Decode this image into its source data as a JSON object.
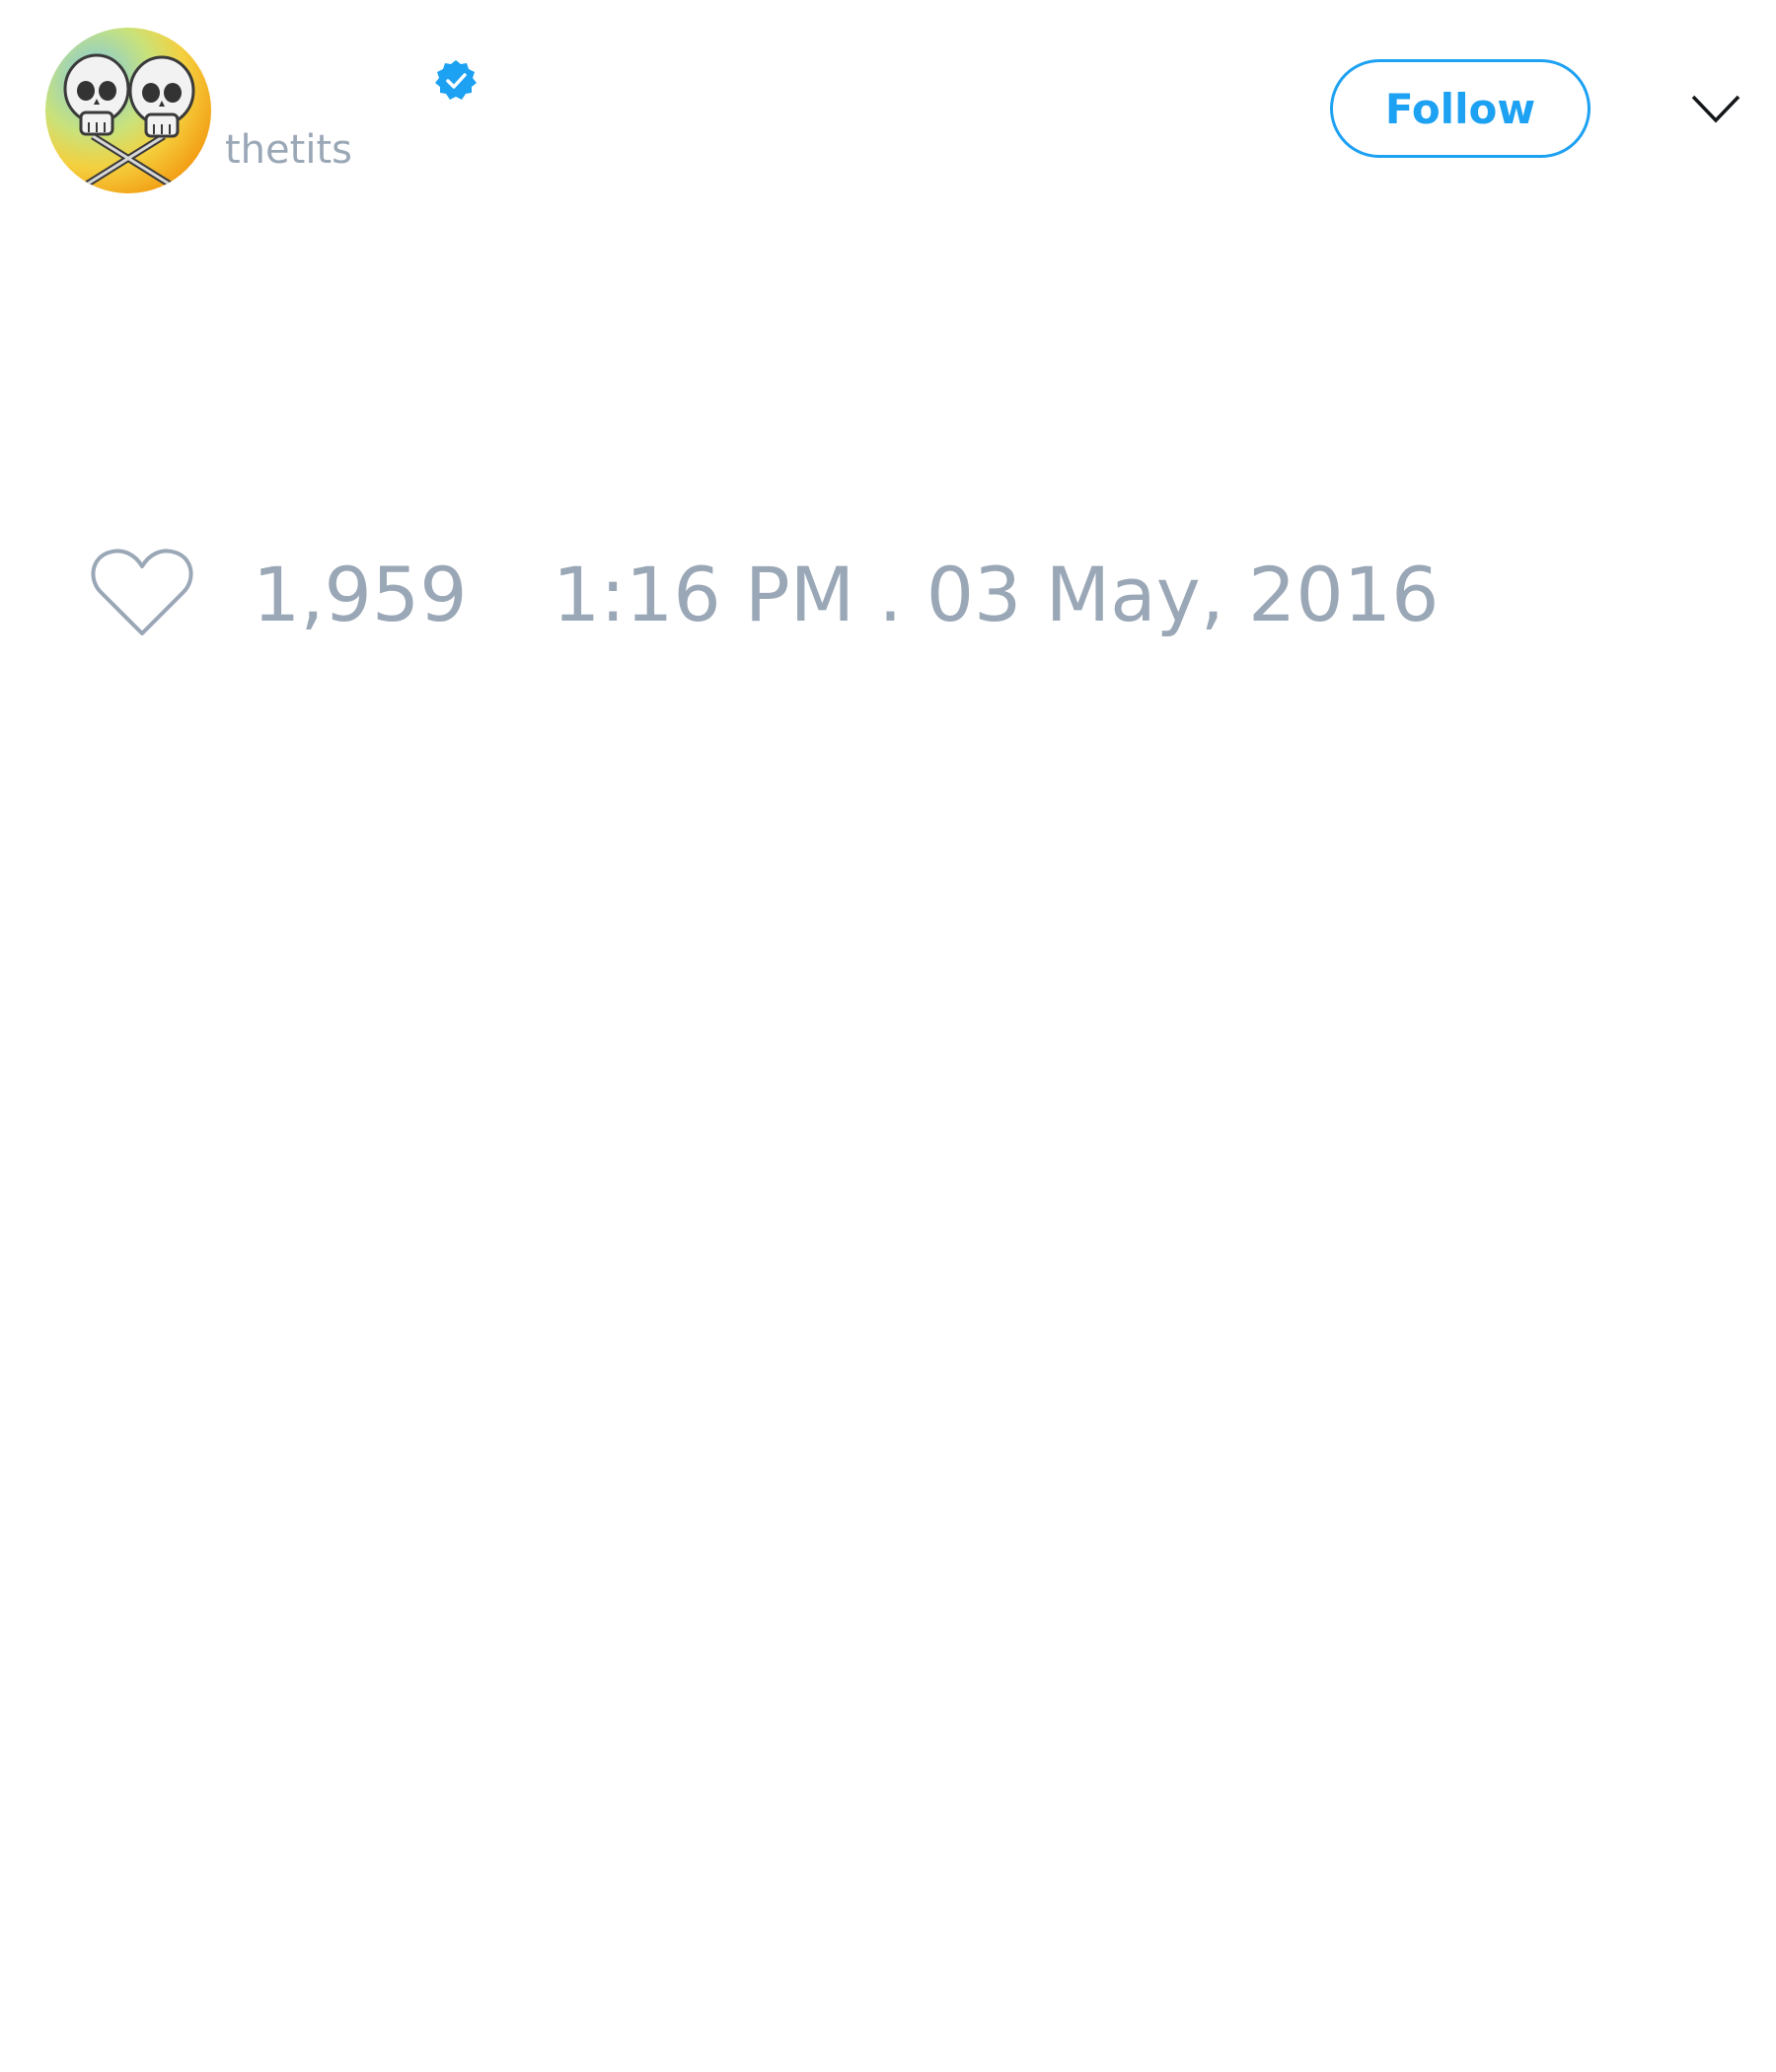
{
  "author": {
    "username": "thetits",
    "verified": true,
    "avatar_icon": "crossed-skulls-avatar"
  },
  "actions": {
    "follow_label": "Follow",
    "menu_icon": "chevron-down-icon"
  },
  "stats": {
    "like_icon": "heart-icon",
    "like_count": "1,959",
    "timestamp": "1:16 PM . 03 May, 2016"
  },
  "colors": {
    "accent": "#1da1f2",
    "muted_text": "#9aa7b6",
    "background": "#ffffff"
  }
}
